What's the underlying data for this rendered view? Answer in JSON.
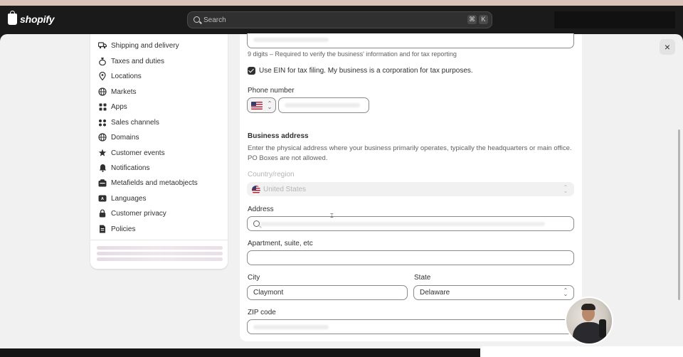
{
  "app": {
    "brand": "shopify",
    "accent": "#303030"
  },
  "topbar": {
    "search_placeholder": "Search",
    "shortcut_keys": [
      "⌘",
      "K"
    ]
  },
  "sidebar": {
    "items": [
      {
        "label": "Shipping and delivery",
        "icon": "truck-icon"
      },
      {
        "label": "Taxes and duties",
        "icon": "money-bag-icon"
      },
      {
        "label": "Locations",
        "icon": "location-pin-icon"
      },
      {
        "label": "Markets",
        "icon": "globe-icon"
      },
      {
        "label": "Apps",
        "icon": "apps-grid-icon"
      },
      {
        "label": "Sales channels",
        "icon": "sales-channels-icon"
      },
      {
        "label": "Domains",
        "icon": "globe-icon"
      },
      {
        "label": "Customer events",
        "icon": "sparkle-icon"
      },
      {
        "label": "Notifications",
        "icon": "bell-icon"
      },
      {
        "label": "Metafields and metaobjects",
        "icon": "metafields-icon"
      },
      {
        "label": "Languages",
        "icon": "language-icon"
      },
      {
        "label": "Customer privacy",
        "icon": "lock-icon"
      },
      {
        "label": "Policies",
        "icon": "document-icon"
      }
    ]
  },
  "form": {
    "ein_help": "9 digits – Required to verify the business' information and for tax reporting",
    "use_ein_checkbox": {
      "label": "Use EIN for tax filing. My business is a corporation for tax purposes.",
      "checked": true
    },
    "phone": {
      "label": "Phone number",
      "country": "US"
    },
    "business_address": {
      "heading": "Business address",
      "description": "Enter the physical address where your business primarily operates, typically the headquarters or main office. PO Boxes are not allowed."
    },
    "country": {
      "label": "Country/region",
      "value": "United States"
    },
    "address": {
      "label": "Address"
    },
    "apartment": {
      "label": "Apartment, suite, etc",
      "value": ""
    },
    "city": {
      "label": "City",
      "value": "Claymont"
    },
    "state": {
      "label": "State",
      "value": "Delaware"
    },
    "zip": {
      "label": "ZIP code"
    }
  },
  "close_label": "×"
}
